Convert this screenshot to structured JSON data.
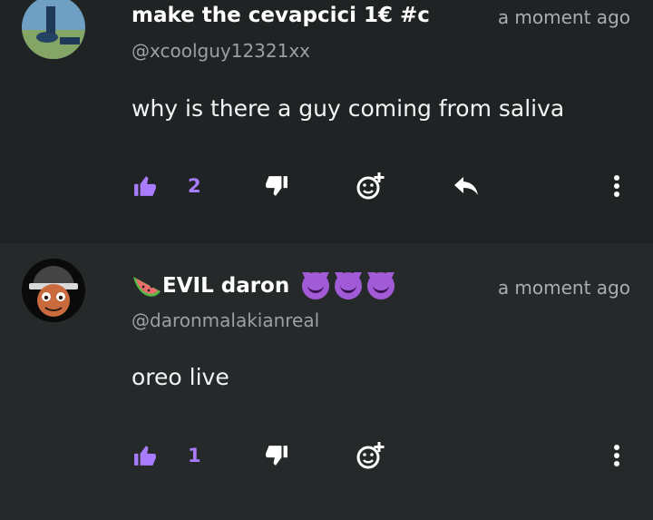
{
  "comments": [
    {
      "display_name": "make the cevapcici 1€ #c",
      "time": "a moment ago",
      "handle": "@xcoolguy12321xx",
      "text": "why is there a guy coming from saliva",
      "likes": "2",
      "avatar_icon": "person-outdoors-avatar"
    },
    {
      "name_prefix_icon": "watermelon-icon",
      "display_name": "EVIL daron",
      "name_suffix_icons": [
        "smiling-devil-icon",
        "smiling-devil-icon",
        "smiling-devil-icon"
      ],
      "time": "a moment ago",
      "handle": "@daronmalakianreal",
      "text": "oreo live",
      "likes": "1",
      "avatar_icon": "cartoon-face-avatar"
    }
  ],
  "colors": {
    "accent": "#a97bff",
    "background_1": "#202324",
    "background_2": "#25292a"
  }
}
